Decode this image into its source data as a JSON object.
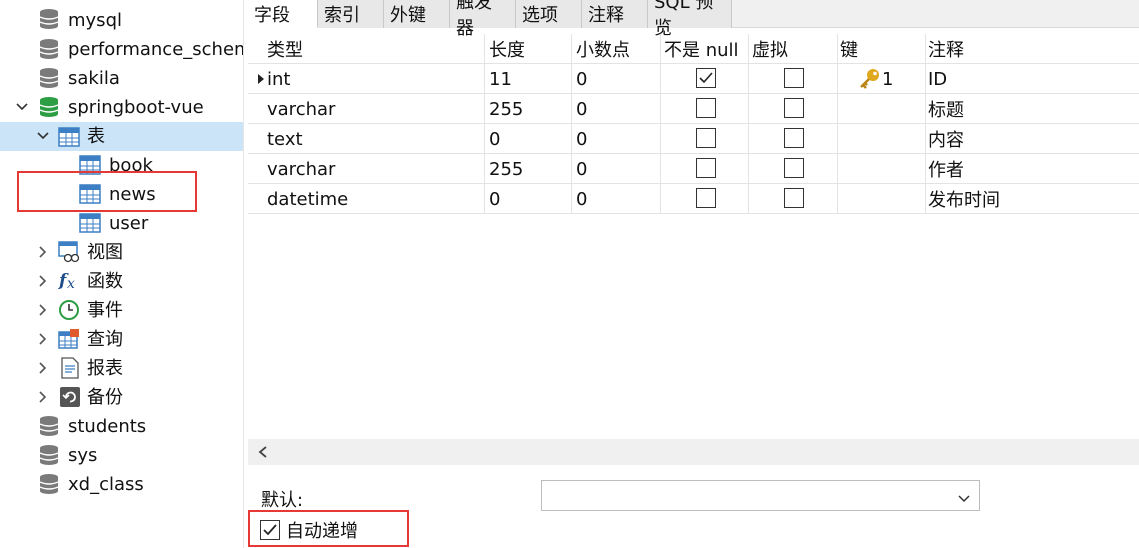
{
  "tree": {
    "items": [
      {
        "label": "mysql",
        "icon": "database-icon"
      },
      {
        "label": "performance_schema",
        "icon": "database-icon"
      },
      {
        "label": "sakila",
        "icon": "database-icon"
      },
      {
        "label": "springboot-vue",
        "icon": "database-active-icon"
      },
      {
        "label": "表",
        "icon": "table-icon"
      },
      {
        "label": "book",
        "icon": "table-icon"
      },
      {
        "label": "news",
        "icon": "table-icon"
      },
      {
        "label": "user",
        "icon": "table-icon"
      },
      {
        "label": "视图",
        "icon": "view-icon"
      },
      {
        "label": "函数",
        "icon": "function-icon"
      },
      {
        "label": "事件",
        "icon": "event-icon"
      },
      {
        "label": "查询",
        "icon": "query-icon"
      },
      {
        "label": "报表",
        "icon": "report-icon"
      },
      {
        "label": "备份",
        "icon": "backup-icon"
      },
      {
        "label": "students",
        "icon": "database-icon"
      },
      {
        "label": "sys",
        "icon": "database-icon"
      },
      {
        "label": "xd_class",
        "icon": "database-icon"
      }
    ]
  },
  "tabs": [
    "字段",
    "索引",
    "外键",
    "触发器",
    "选项",
    "注释",
    "SQL 预览"
  ],
  "grid": {
    "headers": [
      "类型",
      "长度",
      "小数点",
      "不是 null",
      "虚拟",
      "键",
      "注释"
    ],
    "rows": [
      {
        "type": "int",
        "length": "11",
        "decimals": "0",
        "not_null": true,
        "virtual": false,
        "key": "1",
        "comment": "ID"
      },
      {
        "type": "varchar",
        "length": "255",
        "decimals": "0",
        "not_null": false,
        "virtual": false,
        "key": "",
        "comment": "标题"
      },
      {
        "type": "text",
        "length": "0",
        "decimals": "0",
        "not_null": false,
        "virtual": false,
        "key": "",
        "comment": "内容"
      },
      {
        "type": "varchar",
        "length": "255",
        "decimals": "0",
        "not_null": false,
        "virtual": false,
        "key": "",
        "comment": "作者"
      },
      {
        "type": "datetime",
        "length": "0",
        "decimals": "0",
        "not_null": false,
        "virtual": false,
        "key": "",
        "comment": "发布时间"
      }
    ]
  },
  "props": {
    "default_label": "默认:",
    "default_value": "",
    "auto_increment_label": "自动递增",
    "auto_increment_checked": true
  },
  "colors": {
    "selected_row": "#cce4f7",
    "highlight_box": "#e53935",
    "db_active": "#2e9e45",
    "db_gray": "#7a7a7a",
    "table_blue": "#3c7fc4",
    "key_gold": "#e0a81c"
  }
}
